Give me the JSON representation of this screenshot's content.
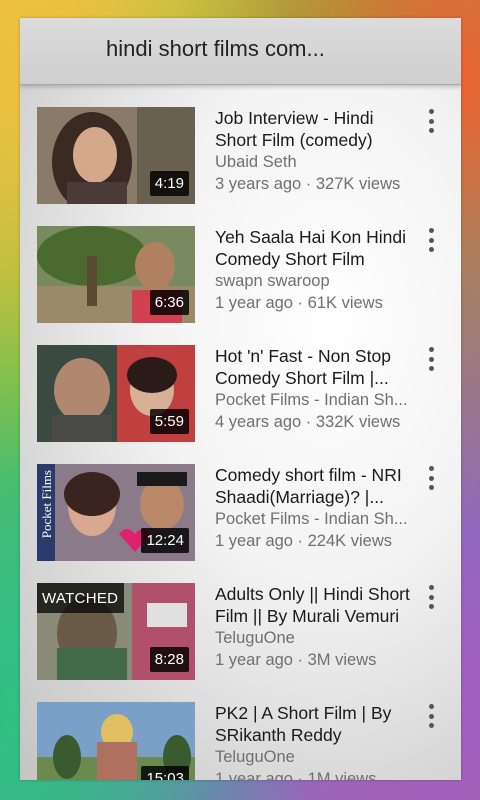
{
  "search": {
    "query": "hindi short films com..."
  },
  "videos": [
    {
      "title": "Job Interview - Hindi Short Film (comedy)",
      "channel": "Ubaid Seth",
      "stats": "3 years ago · 327K views",
      "duration": "4:19",
      "watched": ""
    },
    {
      "title": "Yeh Saala Hai Kon Hindi Comedy Short Film",
      "channel": "swapn swaroop",
      "stats": "1 year ago · 61K views",
      "duration": "6:36",
      "watched": ""
    },
    {
      "title": "Hot 'n' Fast - Non Stop Comedy Short Film |...",
      "channel": "Pocket Films - Indian Sh...",
      "stats": "4 years ago · 332K views",
      "duration": "5:59",
      "watched": ""
    },
    {
      "title": "Comedy short film - NRI Shaadi(Marriage)? |...",
      "channel": "Pocket Films - Indian Sh...",
      "stats": "1 year ago · 224K views",
      "duration": "12:24",
      "watched": "",
      "thumb_text": "Pocket Films"
    },
    {
      "title": "Adults Only || Hindi Short Film || By Murali Vemuri",
      "channel": "TeluguOne",
      "stats": "1 year ago · 3M views",
      "duration": "8:28",
      "watched": "WATCHED"
    },
    {
      "title": "PK2 | A Short Film | By SRikanth Reddy",
      "channel": "TeluguOne",
      "stats": "1 year ago · 1M views",
      "duration": "15:03",
      "watched": ""
    }
  ],
  "colors": {
    "duration_bg": "#000000",
    "title": "#1a1a1a",
    "meta": "#707070"
  }
}
